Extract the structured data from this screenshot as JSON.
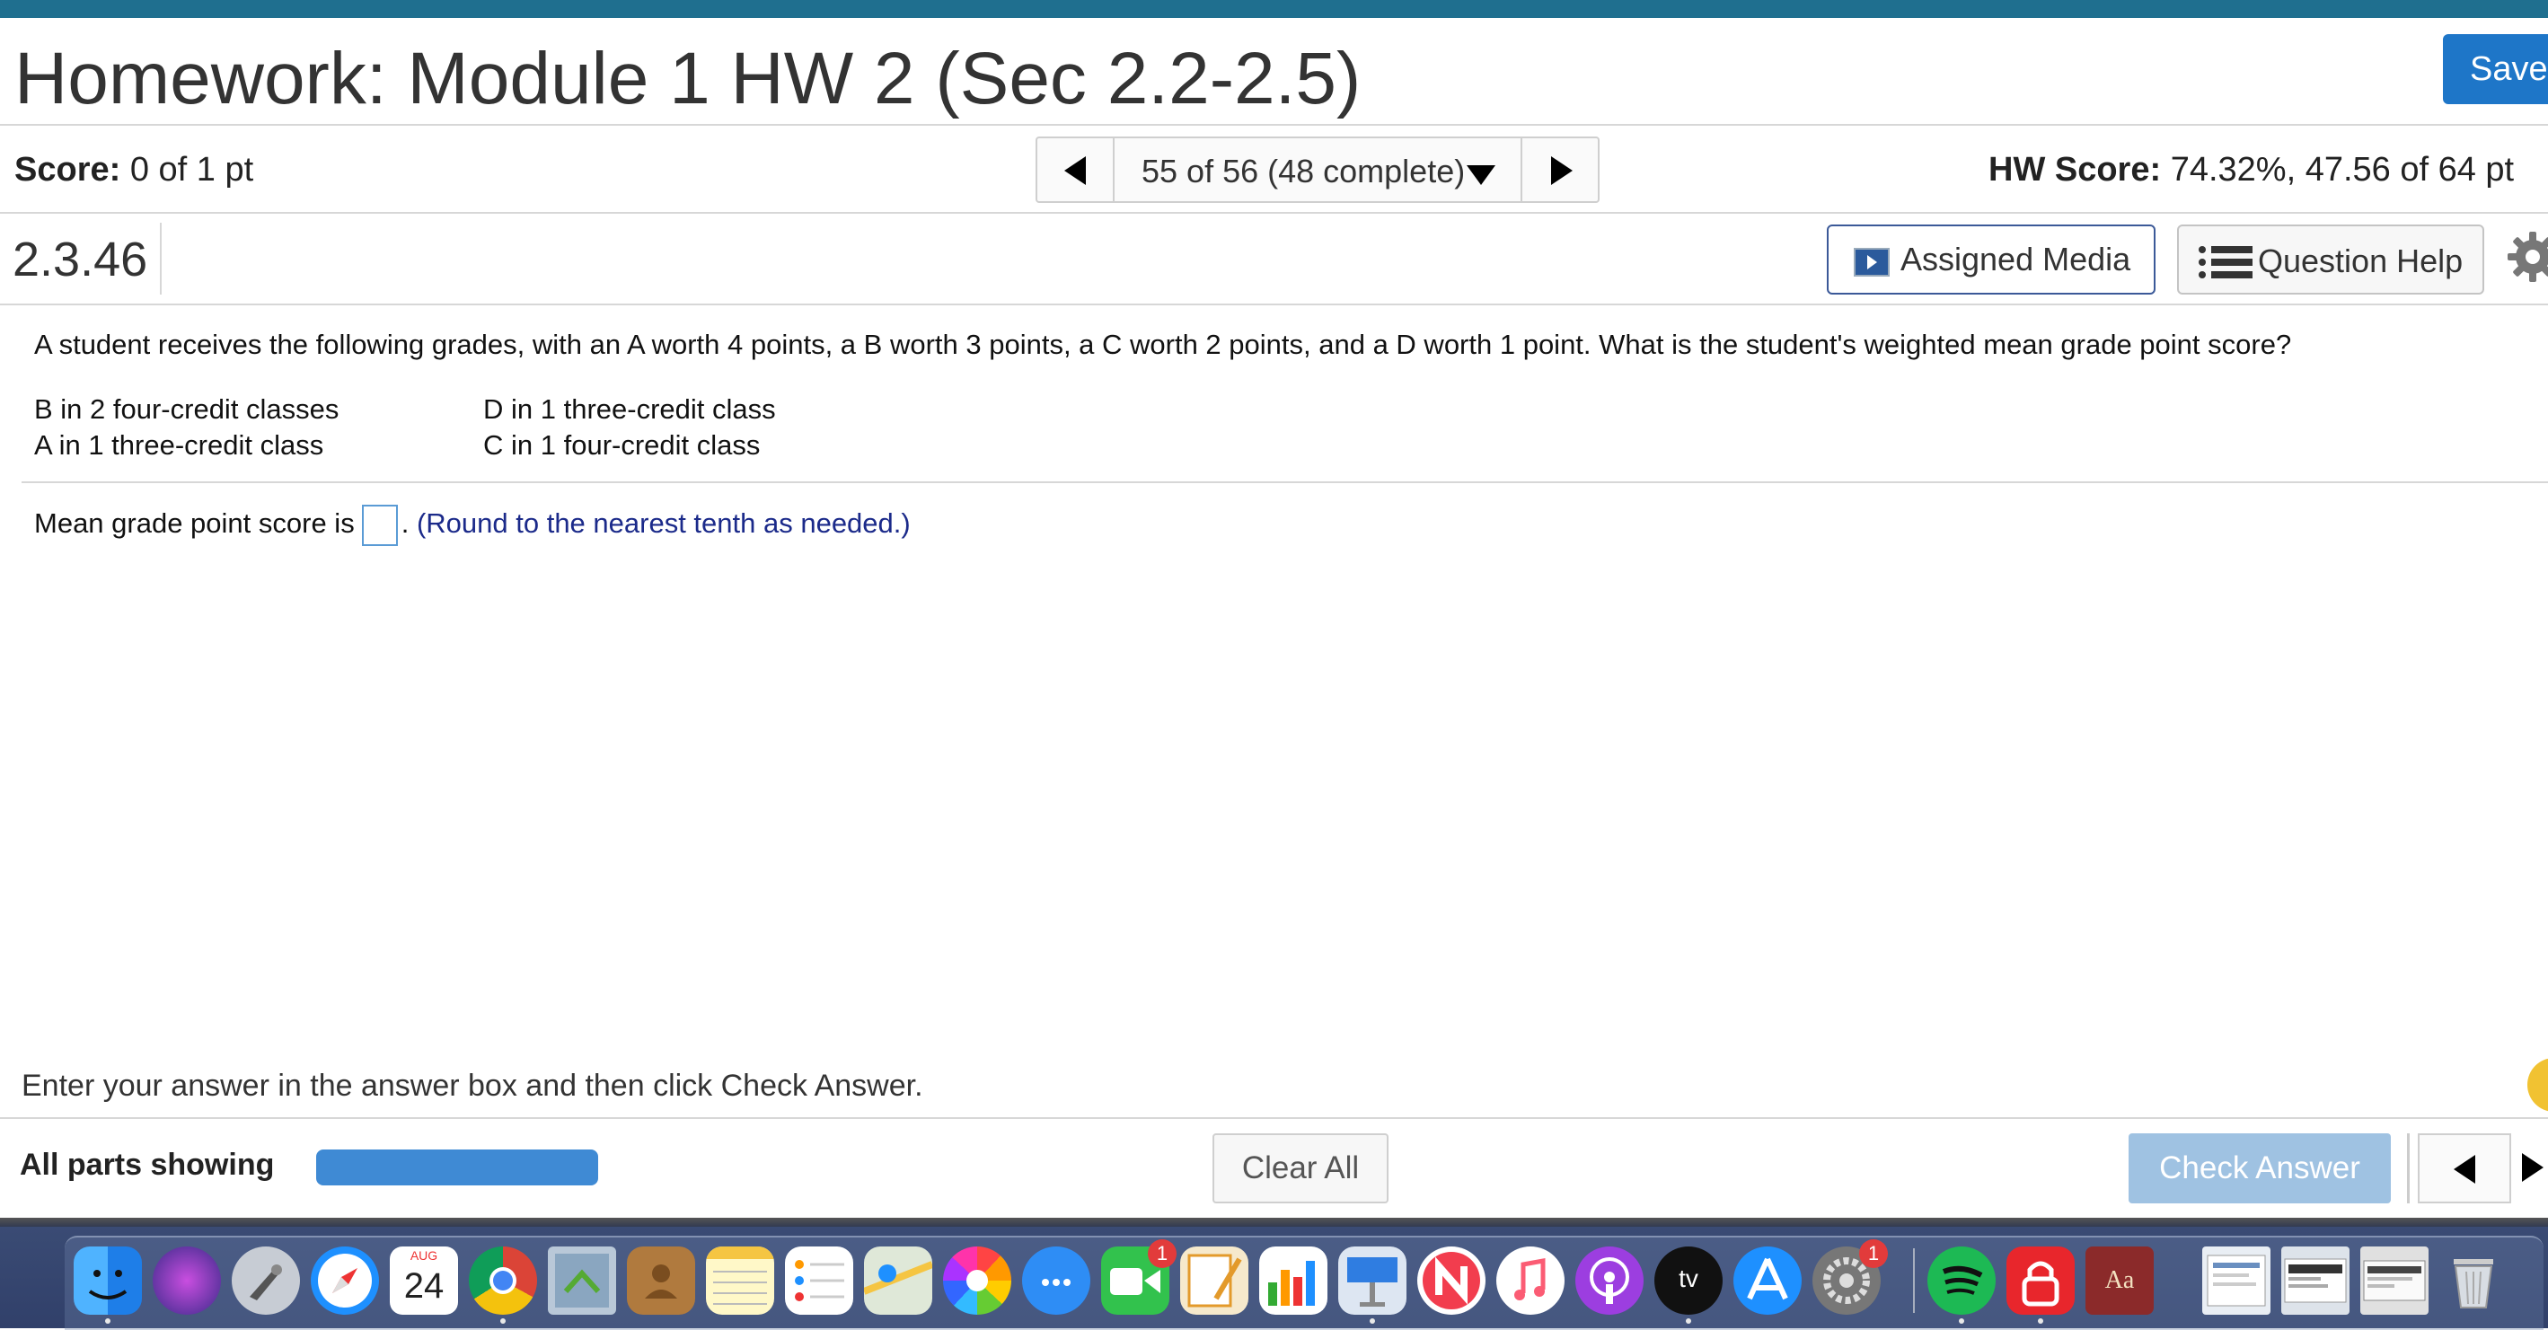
{
  "header": {
    "title": "Homework: Module 1 HW 2 (Sec 2.2-2.5)",
    "save_label": "Save"
  },
  "score_bar": {
    "score_label": "Score:",
    "score_value": "0 of 1 pt",
    "nav_label": "55 of 56 (48 complete)",
    "hw_score_label": "HW Score:",
    "hw_score_value": "74.32%, 47.56 of 64 pt"
  },
  "question_bar": {
    "id": "2.3.46",
    "assigned_media_label": "Assigned Media",
    "question_help_label": "Question Help"
  },
  "question": {
    "prompt": "A student receives the following grades, with an A worth 4 points, a B worth 3 points, a C worth 2 points, and a D worth 1 point. What is the student's weighted mean grade point score?",
    "conditions": [
      "B in 2 four-credit classes",
      "A in 1 three-credit class",
      "D in 1 three-credit class",
      "C in 1 four-credit class"
    ],
    "answer_prefix": "Mean grade point score is",
    "answer_value": "",
    "answer_suffix": ".",
    "round_note": "(Round to the nearest tenth as needed.)"
  },
  "footer": {
    "instruction": "Enter your answer in the answer box and then click Check Answer.",
    "all_parts_label": "All parts showing",
    "progress_fraction": 1.0,
    "clear_all_label": "Clear All",
    "check_answer_label": "Check Answer"
  },
  "dock": {
    "calendar_month": "AUG",
    "calendar_day": "24",
    "facetime_badge": "1",
    "settings_badge": "1",
    "appletv_label": "tv",
    "dictionary_label": "Aa"
  },
  "colors": {
    "accent": "#1e76c8",
    "top_bar": "#1f6f8f",
    "progress": "#3f8ad4",
    "check_button": "#9fc2e2",
    "note_text": "#1b2a8a"
  }
}
